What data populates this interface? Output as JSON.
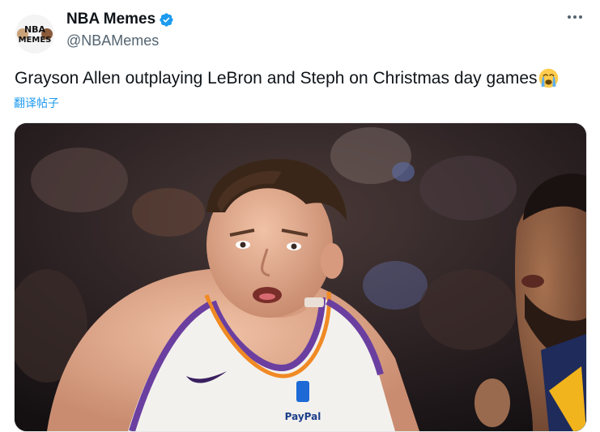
{
  "author": {
    "display_name": "NBA Memes",
    "handle": "@NBAMemes",
    "avatar_text_top": "NBA",
    "avatar_text_bottom": "MEMES",
    "verified_color": "#1d9bf0"
  },
  "tweet": {
    "text": "Grayson Allen outplaying LeBron and Steph on Christmas day games",
    "emoji": "crying-face",
    "translate_label": "翻译帖子"
  },
  "media": {
    "jersey_sponsor": "PayPal"
  },
  "icons": {
    "more": "more-horizontal-icon",
    "verified": "verified-badge-icon"
  },
  "colors": {
    "link": "#1d9bf0",
    "text": "#0f1419",
    "secondary_text": "#536471"
  }
}
